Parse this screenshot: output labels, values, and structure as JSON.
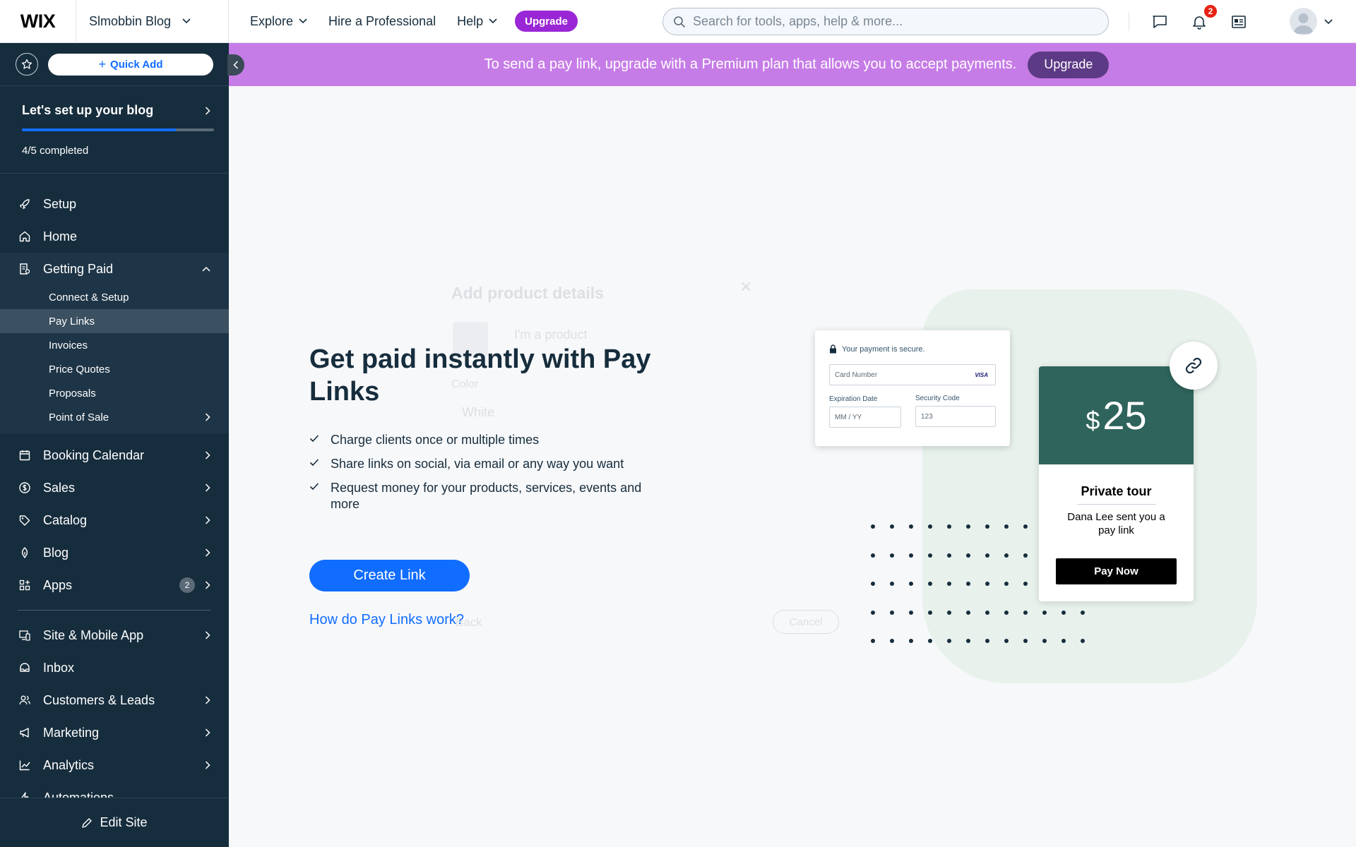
{
  "topbar": {
    "logo": "WIX",
    "site_name": "Slmobbin Blog",
    "nav": {
      "explore": "Explore",
      "hire": "Hire a Professional",
      "help": "Help"
    },
    "upgrade_label": "Upgrade",
    "search_placeholder": "Search for tools, apps, help & more...",
    "notifications_count": "2"
  },
  "sidebar": {
    "quick_add": "Quick Add",
    "setup": {
      "title": "Let's set up your blog",
      "progress_text": "4/5 completed",
      "progress_fraction": 0.8
    },
    "items": {
      "setup": "Setup",
      "home": "Home",
      "getting_paid": "Getting Paid",
      "booking_calendar": "Booking Calendar",
      "sales": "Sales",
      "catalog": "Catalog",
      "blog": "Blog",
      "apps": "Apps",
      "apps_badge": "2",
      "site_mobile": "Site & Mobile App",
      "inbox": "Inbox",
      "customers": "Customers & Leads",
      "marketing": "Marketing",
      "analytics": "Analytics",
      "automations": "Automations"
    },
    "getting_paid_sub": {
      "connect": "Connect & Setup",
      "pay_links": "Pay Links",
      "invoices": "Invoices",
      "price_quotes": "Price Quotes",
      "proposals": "Proposals",
      "pos": "Point of Sale"
    },
    "edit_site": "Edit Site"
  },
  "banner": {
    "text": "To send a pay link, upgrade with a Premium plan that allows you to accept payments.",
    "button": "Upgrade"
  },
  "main": {
    "title": "Get paid instantly with Pay Links",
    "bullets": [
      "Charge clients once or multiple times",
      "Share links on social, via email or any way you want",
      "Request money for your products, services, events and more"
    ],
    "create_button": "Create Link",
    "help_link": "How do Pay Links work?"
  },
  "ghost_modal": {
    "title": "Add product details",
    "product": "I'm a product",
    "color_label": "Color",
    "color_value": "White",
    "back": "Back",
    "cancel": "Cancel"
  },
  "illustration": {
    "secure_text": "Your payment is secure.",
    "card_number": "Card Number",
    "card_brand": "VISA",
    "expiration_label": "Expiration Date",
    "expiration_placeholder": "MM / YY",
    "security_label": "Security Code",
    "security_value": "123",
    "currency": "$",
    "amount": "25",
    "item_title": "Private tour",
    "description": "Dana Lee sent you a pay link",
    "pay_button": "Pay Now"
  },
  "colors": {
    "sidebar_bg": "#162d3d",
    "accent_blue": "#116dff",
    "banner_purple": "#c67ce6",
    "upgrade_purple": "#9a27d5",
    "card_green": "#2e645c"
  }
}
